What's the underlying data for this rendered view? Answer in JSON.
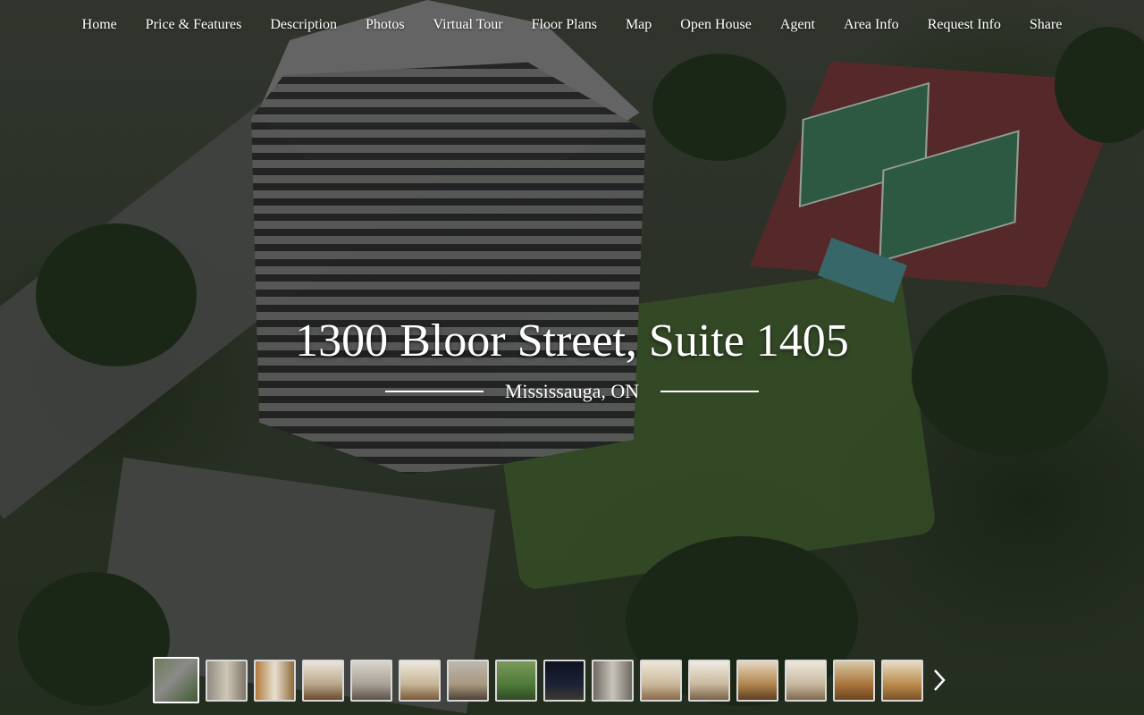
{
  "nav": {
    "items": [
      "Home",
      "Price & Features",
      "Description",
      "Photos",
      "Virtual Tour",
      "Floor Plans",
      "Map",
      "Open House",
      "Agent",
      "Area Info",
      "Request Info",
      "Share"
    ]
  },
  "hero": {
    "address": "1300 Bloor Street, Suite 1405",
    "city": "Mississauga, ON"
  },
  "gallery": {
    "thumbnail_count": 16,
    "selected_index": 0,
    "next_icon": "chevron-right-icon"
  },
  "colors": {
    "text": "#ffffff",
    "thumb_border": "#d8d8d8"
  }
}
